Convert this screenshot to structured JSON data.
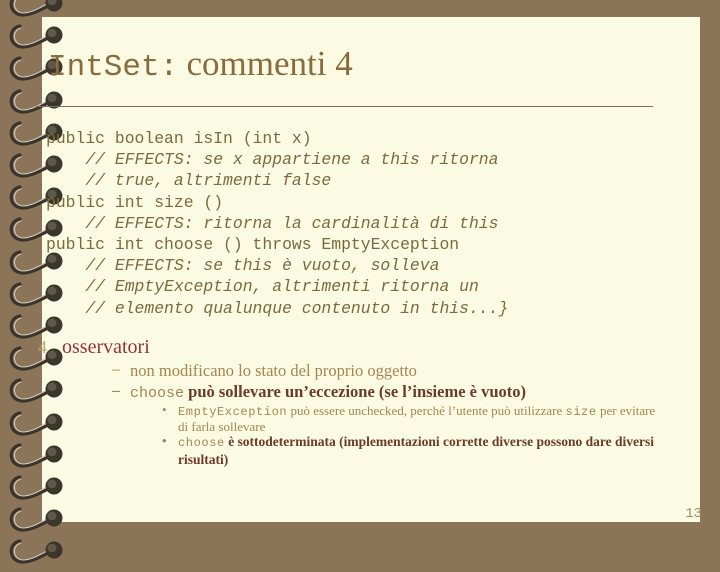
{
  "slide": {
    "title_mono": "IntSet:",
    "title_serif": "commenti 4",
    "page_number": "13",
    "theme": {
      "paper": "#fbfbe4",
      "border": "#8c7459",
      "title_color": "#8a6b3c",
      "code_color": "#7a6a3e",
      "heading_color": "#9a2f3e",
      "bullet_color": "#a58550",
      "emphasis_color": "#6b3a28",
      "rule_color": "#7a705e",
      "page_number_color": "#9a9068"
    }
  },
  "code": {
    "lines": [
      {
        "indent": 0,
        "text": "public boolean isIn (int x)",
        "comment": false
      },
      {
        "indent": 1,
        "text": "// EFFECTS: se x appartiene a this ritorna",
        "comment": true
      },
      {
        "indent": 1,
        "text": "// true, altrimenti false",
        "comment": true
      },
      {
        "indent": 0,
        "text": "public int size ()",
        "comment": false
      },
      {
        "indent": 1,
        "text": "// EFFECTS: ritorna la cardinalità di this",
        "comment": true
      },
      {
        "indent": 0,
        "text": "public int choose () throws EmptyException",
        "comment": false
      },
      {
        "indent": 1,
        "text": "// EFFECTS: se this è vuoto, solleva",
        "comment": true
      },
      {
        "indent": 1,
        "text": "// EmptyException, altrimenti ritorna un",
        "comment": true
      },
      {
        "indent": 1,
        "text": "// elemento qualunque contenuto in this...}",
        "comment": true
      }
    ]
  },
  "bullets": {
    "level1": {
      "marker": "4",
      "label": "osservatori"
    },
    "level2": [
      {
        "marker": "–",
        "mono": "",
        "text": "non modificano lo stato del proprio oggetto",
        "strong": false
      },
      {
        "marker": "–",
        "mono": "choose",
        "text": " può sollevare un’eccezione (se l’insieme è vuoto)",
        "strong": true
      }
    ],
    "level3": [
      {
        "marker": "•",
        "mono1": "EmptyException",
        "text1": "  può essere unchecked, perché l’utente può utilizzare ",
        "mono2": "size",
        "text2": "  per evitare di farla sollevare",
        "strong": false
      },
      {
        "marker": "•",
        "mono1": "choose",
        "text1": " è sottodeterminata (implementazioni corrette diverse possono dare diversi risultati)",
        "mono2": "",
        "text2": "",
        "strong": true
      }
    ]
  }
}
